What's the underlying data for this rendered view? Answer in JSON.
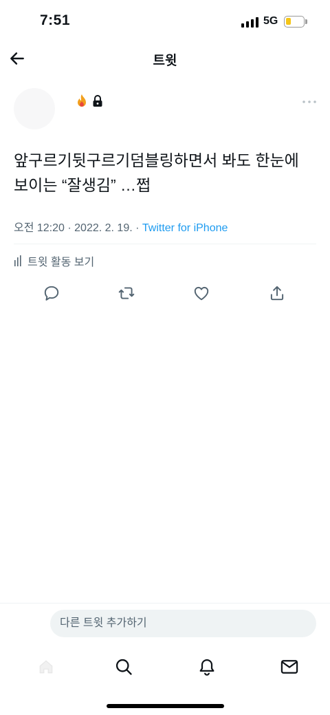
{
  "status": {
    "time": "7:51",
    "network": "5G"
  },
  "header": {
    "title": "트윗"
  },
  "tweet": {
    "text_line1": "앞구르기뒷구르기덤블링하면서 봐도 한눈에",
    "text_line2": "보이는 “잘생김” …쩝",
    "time": "오전 12:20",
    "sep1": " · ",
    "date": "2022. 2. 19.",
    "sep2": " · ",
    "source": "Twitter for iPhone",
    "activity_label": "트윗 활동 보기"
  },
  "reply": {
    "placeholder": "다른 트윗 추가하기"
  },
  "icons": {
    "back": "arrow-left-icon",
    "lock": "lock-icon",
    "emoji": "flame-emoji-icon",
    "more": "more-dots-icon",
    "activity": "bar-chart-icon",
    "reply": "reply-icon",
    "retweet": "retweet-icon",
    "like": "heart-icon",
    "share": "share-icon",
    "home": "home-icon",
    "search": "search-icon",
    "notifications": "bell-icon",
    "messages": "mail-icon"
  },
  "colors": {
    "accent": "#1d9bf0",
    "secondary_text": "#536471",
    "battery": "#f5c518"
  }
}
